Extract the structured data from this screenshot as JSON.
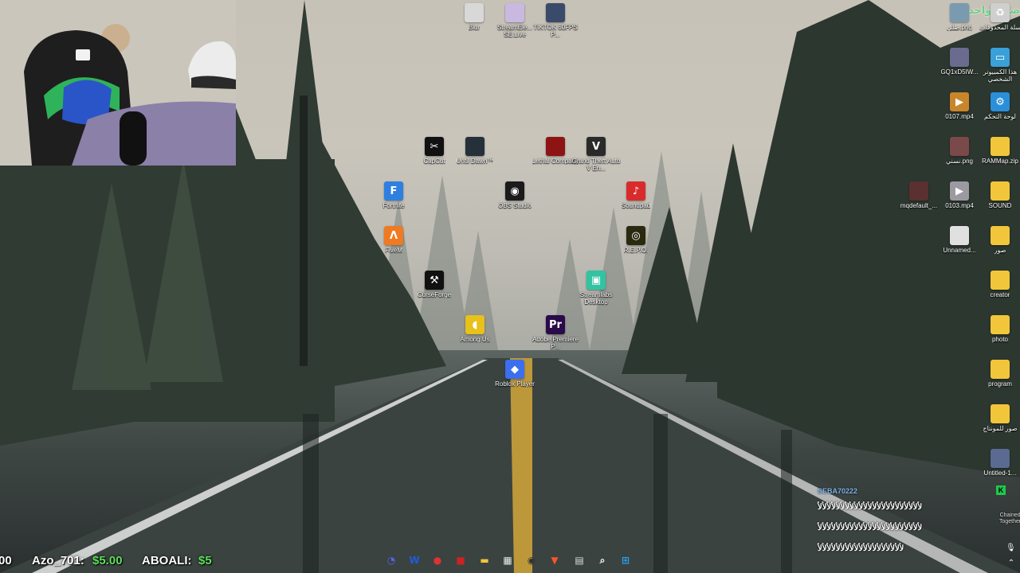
{
  "overlay": {
    "top_right_text": "صلي واحدي"
  },
  "desktop_icons": [
    {
      "id": "blur",
      "label": "Blur",
      "icon": "file-icon",
      "color": "#d8d8d8",
      "glyph": ""
    },
    {
      "id": "streamelements",
      "label": "StreamEle... SE.Live",
      "icon": "streamelements-icon",
      "color": "#c9b9e0",
      "glyph": ""
    },
    {
      "id": "tiktok-shortcut",
      "label": "TIKTOK 60FPS P...",
      "icon": "photo-icon",
      "color": "#3a4a6a",
      "glyph": ""
    },
    {
      "id": "capcut",
      "label": "CapCut",
      "icon": "capcut-icon",
      "color": "#111111",
      "glyph": "✂"
    },
    {
      "id": "until-dawn",
      "label": "Until Dawn™",
      "icon": "game-icon",
      "color": "#25303a",
      "glyph": ""
    },
    {
      "id": "lethal-company",
      "label": "Lethal Company",
      "icon": "game-icon",
      "color": "#8e1414",
      "glyph": ""
    },
    {
      "id": "gta-v",
      "label": "Grand Theft Auto V En...",
      "icon": "gta-icon",
      "color": "#2a2a2a",
      "glyph": "V"
    },
    {
      "id": "fortnite",
      "label": "Fortnite",
      "icon": "fortnite-icon",
      "color": "#2f7fe0",
      "glyph": "F"
    },
    {
      "id": "obs",
      "label": "OBS Studio",
      "icon": "obs-icon",
      "color": "#1b1b1b",
      "glyph": "◉"
    },
    {
      "id": "soundpad",
      "label": "Soundpad",
      "icon": "soundpad-icon",
      "color": "#d92b2b",
      "glyph": "♪"
    },
    {
      "id": "fivem",
      "label": "FiveM",
      "icon": "fivem-icon",
      "color": "#f07a22",
      "glyph": "Λ"
    },
    {
      "id": "repo",
      "label": "R.E.P.O.",
      "icon": "game-icon",
      "color": "#2a2a10",
      "glyph": "◎"
    },
    {
      "id": "curseforge",
      "label": "CurseForge",
      "icon": "curseforge-icon",
      "color": "#111111",
      "glyph": "⚒"
    },
    {
      "id": "streamlabs",
      "label": "Streamlabs Desktop",
      "icon": "streamlabs-icon",
      "color": "#31c3a2",
      "glyph": "▣"
    },
    {
      "id": "among-us",
      "label": "Among Us",
      "icon": "among-us-icon",
      "color": "#e8c11a",
      "glyph": "◖"
    },
    {
      "id": "premiere",
      "label": "Adobe Premiere P...",
      "icon": "premiere-icon",
      "color": "#2a0a4a",
      "glyph": "Pr"
    },
    {
      "id": "roblox",
      "label": "Roblox Player",
      "icon": "roblox-icon",
      "color": "#3b6ff0",
      "glyph": "◆"
    }
  ],
  "right_icons": [
    {
      "id": "r1a",
      "label": "صلي.png",
      "icon": "image-icon",
      "color": "#7a9ab0",
      "glyph": ""
    },
    {
      "id": "r1b",
      "label": "سلة المحذوفات",
      "icon": "recycle-bin-icon",
      "color": "#cfcfcf",
      "glyph": "♻"
    },
    {
      "id": "r2a",
      "label": "GQ1xD5IW...",
      "icon": "image-icon",
      "color": "#6b6b90",
      "glyph": ""
    },
    {
      "id": "r2b",
      "label": "هذا الكمبيوتر الشخصي",
      "icon": "this-pc-icon",
      "color": "#3aa0d8",
      "glyph": "▭"
    },
    {
      "id": "r3a",
      "label": "0107.mp4",
      "icon": "video-icon",
      "color": "#c8862a",
      "glyph": "▶"
    },
    {
      "id": "r3b",
      "label": "لوحة التحكم",
      "icon": "control-panel-icon",
      "color": "#2a8fd8",
      "glyph": "⚙"
    },
    {
      "id": "r4a",
      "label": "نسني.png",
      "icon": "image-icon",
      "color": "#7a4a4a",
      "glyph": ""
    },
    {
      "id": "r4b",
      "label": "RAMMap.zip",
      "icon": "zip-folder-icon",
      "color": "#f2c63a",
      "glyph": ""
    },
    {
      "id": "r5a",
      "label": "mqdefault_...",
      "icon": "image-icon",
      "color": "#5a3030",
      "glyph": ""
    },
    {
      "id": "r5b",
      "label": "0103.mp4",
      "icon": "video-icon",
      "color": "#9a9aa0",
      "glyph": "▶"
    },
    {
      "id": "r5c",
      "label": "SOUND",
      "icon": "folder-icon",
      "color": "#f2c63a",
      "glyph": ""
    },
    {
      "id": "r6a",
      "label": "Unnamed...",
      "icon": "image-icon",
      "color": "#e0e0e0",
      "glyph": ""
    },
    {
      "id": "r6b",
      "label": "صور",
      "icon": "folder-icon",
      "color": "#f2c63a",
      "glyph": ""
    },
    {
      "id": "r7",
      "label": "creator",
      "icon": "folder-icon",
      "color": "#f2c63a",
      "glyph": ""
    },
    {
      "id": "r8",
      "label": "photo",
      "icon": "folder-icon",
      "color": "#f2c63a",
      "glyph": ""
    },
    {
      "id": "r9",
      "label": "program",
      "icon": "folder-icon",
      "color": "#f2c63a",
      "glyph": ""
    },
    {
      "id": "r10",
      "label": "صور للمونتاج",
      "icon": "folder-icon",
      "color": "#f2c63a",
      "glyph": ""
    },
    {
      "id": "r11",
      "label": "Untitled-1...",
      "icon": "image-icon",
      "color": "#5a6a90",
      "glyph": ""
    }
  ],
  "ticker": {
    "left_fragment": "00",
    "item1_name": "Azo_701:",
    "item1_amount": "$5.00",
    "item2_name": "ABOALI:",
    "item2_amount": "$5"
  },
  "taskbar": [
    {
      "id": "discord",
      "icon": "discord-icon",
      "color": "#5865f2",
      "glyph": "◔"
    },
    {
      "id": "edge-like",
      "icon": "app-icon",
      "color": "#1e5be0",
      "glyph": "W"
    },
    {
      "id": "chrome",
      "icon": "chrome-icon",
      "color": "#d33",
      "glyph": "●"
    },
    {
      "id": "capture",
      "icon": "recorder-icon",
      "color": "#c22",
      "glyph": "■"
    },
    {
      "id": "explorer",
      "icon": "file-explorer-icon",
      "color": "#f2c63a",
      "glyph": "▬"
    },
    {
      "id": "store",
      "icon": "store-icon",
      "color": "#e8e8e8",
      "glyph": "▦"
    },
    {
      "id": "obs-tb",
      "icon": "obs-icon",
      "color": "#333",
      "glyph": "◉"
    },
    {
      "id": "brave",
      "icon": "brave-icon",
      "color": "#fb542b",
      "glyph": "▼"
    },
    {
      "id": "taskview",
      "icon": "task-view-icon",
      "color": "#ddd",
      "glyph": "▤"
    },
    {
      "id": "search",
      "icon": "search-icon",
      "color": "#ffffff",
      "glyph": "⌕"
    },
    {
      "id": "start",
      "icon": "windows-start-icon",
      "color": "#2aa0f0",
      "glyph": "⊞"
    }
  ],
  "chat": {
    "username": "SEBA70222",
    "badge": "K",
    "line1": "ﻷﻷﻷﻷﻷﻷﻷﻷﻷﻷﻷﻷﻷﻷﻷﻷﻷﻷﻷﻷﻷﻷﻷ",
    "line2": "ﻷﻷﻷﻷﻷﻷﻷﻷﻷﻷﻷﻷﻷﻷﻷﻷﻷﻷﻷﻷﻷﻷﻷ",
    "line3": "ﻷﻷﻷﻷﻷﻷﻷﻷﻷﻷﻷﻷﻷﻷﻷﻷﻷﻷﻷ",
    "side_text_1": "Chained",
    "side_text_2": "Together"
  }
}
